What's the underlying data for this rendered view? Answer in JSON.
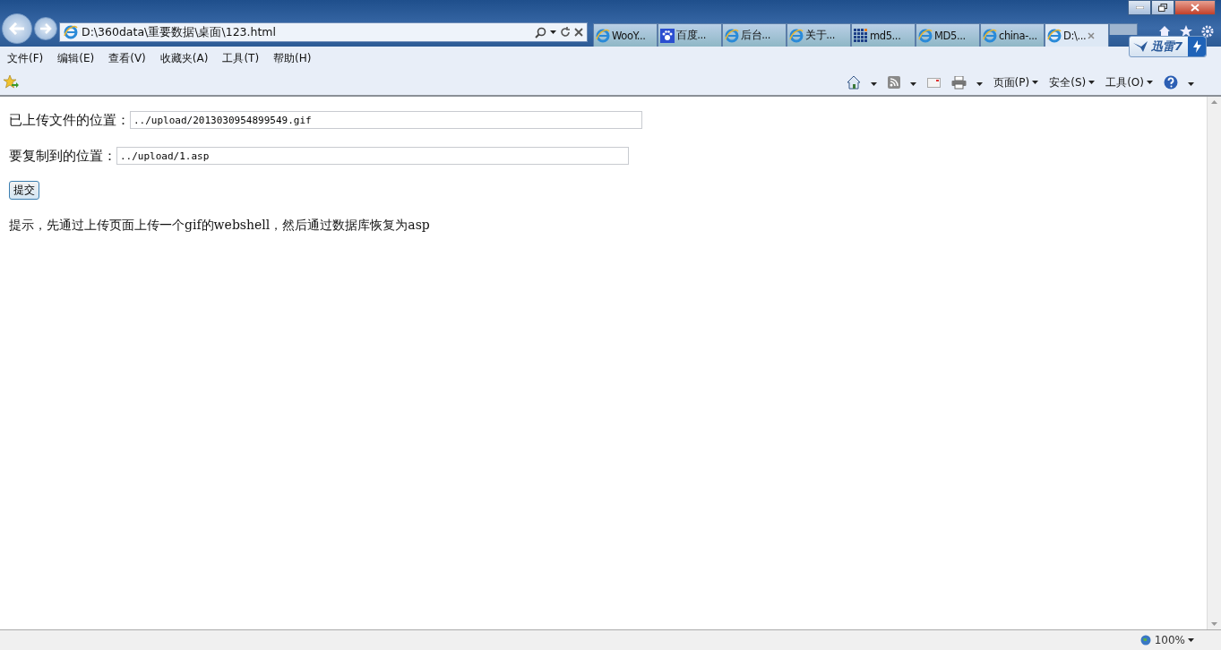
{
  "address_bar": {
    "url": "D:\\360data\\重要数据\\桌面\\123.html"
  },
  "tabs": [
    {
      "label": "WooY...",
      "kind": "ie",
      "selected": false
    },
    {
      "label": "百度...",
      "kind": "paw",
      "selected": false
    },
    {
      "label": "后台...",
      "kind": "ie",
      "selected": false
    },
    {
      "label": "关于...",
      "kind": "ie",
      "selected": false
    },
    {
      "label": "md5...",
      "kind": "grid",
      "selected": false
    },
    {
      "label": "MD5...",
      "kind": "ie",
      "selected": false
    },
    {
      "label": "china-...",
      "kind": "ie",
      "selected": false
    },
    {
      "label": "D:\\...",
      "kind": "ie",
      "selected": true
    }
  ],
  "xunlei_badge": {
    "label": "迅雷7"
  },
  "menu_bar": [
    "文件(F)",
    "编辑(E)",
    "查看(V)",
    "收藏夹(A)",
    "工具(T)",
    "帮助(H)"
  ],
  "command_bar": [
    {
      "kind": "home"
    },
    {
      "kind": "feed"
    },
    {
      "kind": "mail"
    },
    {
      "kind": "print"
    },
    {
      "kind": "menu",
      "label": "页面(P)"
    },
    {
      "kind": "menu",
      "label": "安全(S)"
    },
    {
      "kind": "menu",
      "label": "工具(O)"
    },
    {
      "kind": "help"
    }
  ],
  "form": {
    "fields": [
      {
        "label": "已上传文件的位置：",
        "value": "../upload/2013030954899549.gif"
      },
      {
        "label": "要复制到的位置：",
        "value": "../upload/1.asp"
      }
    ],
    "submit": "提交",
    "hint": "提示，先通过上传页面上传一个gif的webshell，然后通过数据库恢复为asp"
  },
  "status_bar": {
    "zoom": "100%"
  }
}
